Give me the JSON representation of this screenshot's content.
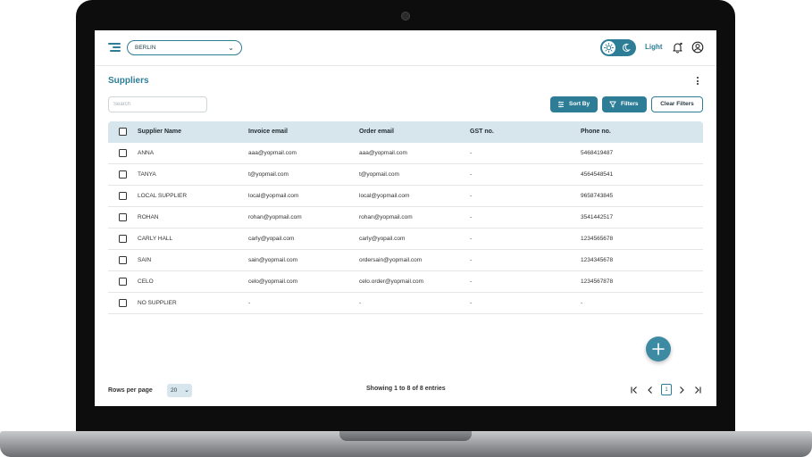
{
  "header": {
    "location": "BERLIN",
    "theme_label": "Light"
  },
  "page": {
    "title": "Suppliers",
    "search_placeholder": "Search",
    "sort_label": "Sort By",
    "filters_label": "Filters",
    "clear_filters_label": "Clear Filters"
  },
  "table": {
    "columns": [
      "Supplier Name",
      "Invoice email",
      "Order email",
      "GST no.",
      "Phone no."
    ],
    "rows": [
      [
        "ANNA",
        "aaa@yopmail.com",
        "aaa@yopmail.com",
        "-",
        "5468419487"
      ],
      [
        "TANYA",
        "t@yopmail.com",
        "t@yopmail.com",
        "-",
        "4564548541"
      ],
      [
        "LOCAL SUPPLIER",
        "local@yopmail.com",
        "local@yopmail.com",
        "-",
        "9658743845"
      ],
      [
        "ROHAN",
        "rohan@yopmail.com",
        "rohan@yopmail.com",
        "-",
        "3541442517"
      ],
      [
        "CARLY HALL",
        "carly@yopail.com",
        "carly@yopail.com",
        "-",
        "1234565678"
      ],
      [
        "SAIN",
        "sain@yopmail.com",
        "ordersain@yopmail.com",
        "-",
        "1234345678"
      ],
      [
        "CELO",
        "celo@yopmail.com",
        "celo.order@yopmail.com",
        "-",
        "1234567878"
      ],
      [
        "NO SUPPLIER",
        "-",
        "-",
        "-",
        "-"
      ]
    ]
  },
  "footer": {
    "rows_per_page_label": "Rows per page",
    "rows_per_page_value": "20",
    "entries_text": "Showing 1 to 8 of 8 entries",
    "current_page": "1"
  },
  "colors": {
    "accent": "#2e7d96",
    "header_row": "#d6e6ec",
    "fab": "#3d8aa3"
  }
}
